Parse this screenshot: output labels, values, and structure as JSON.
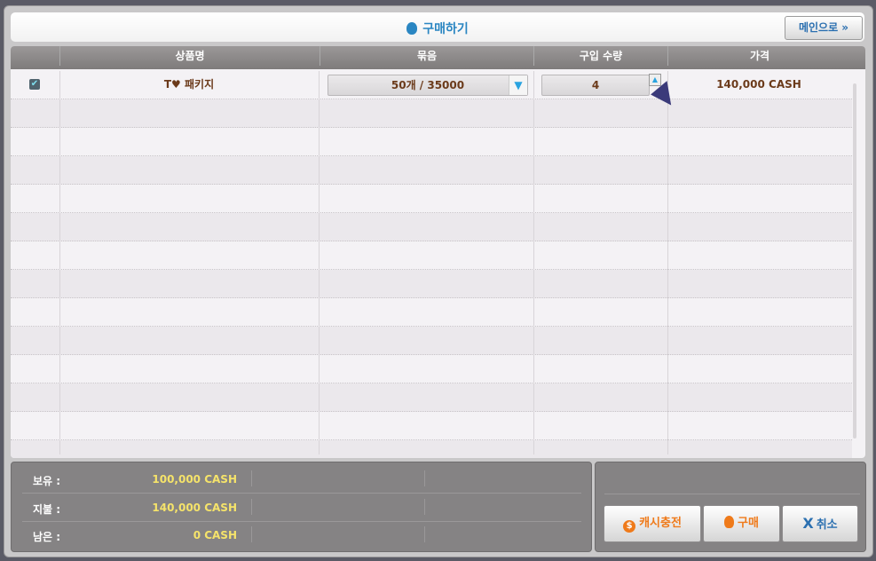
{
  "header": {
    "title": "구매하기",
    "main_button": "메인으로 »"
  },
  "columns": [
    "상품명",
    "묶음",
    "구입 수량",
    "가격"
  ],
  "item": {
    "checked": true,
    "name": "T♥ 패키지",
    "bundle": "50개 / 35000",
    "quantity": "4",
    "price": "140,000 CASH"
  },
  "summary": [
    {
      "label": "보유 :",
      "value": "100,000 CASH"
    },
    {
      "label": "지불 :",
      "value": "140,000 CASH"
    },
    {
      "label": "남은 :",
      "value": "0 CASH"
    }
  ],
  "buttons": {
    "charge": "캐시충전",
    "buy": "구매",
    "cancel": "취소"
  },
  "icons": {
    "charge": "$",
    "cancel": "X"
  }
}
